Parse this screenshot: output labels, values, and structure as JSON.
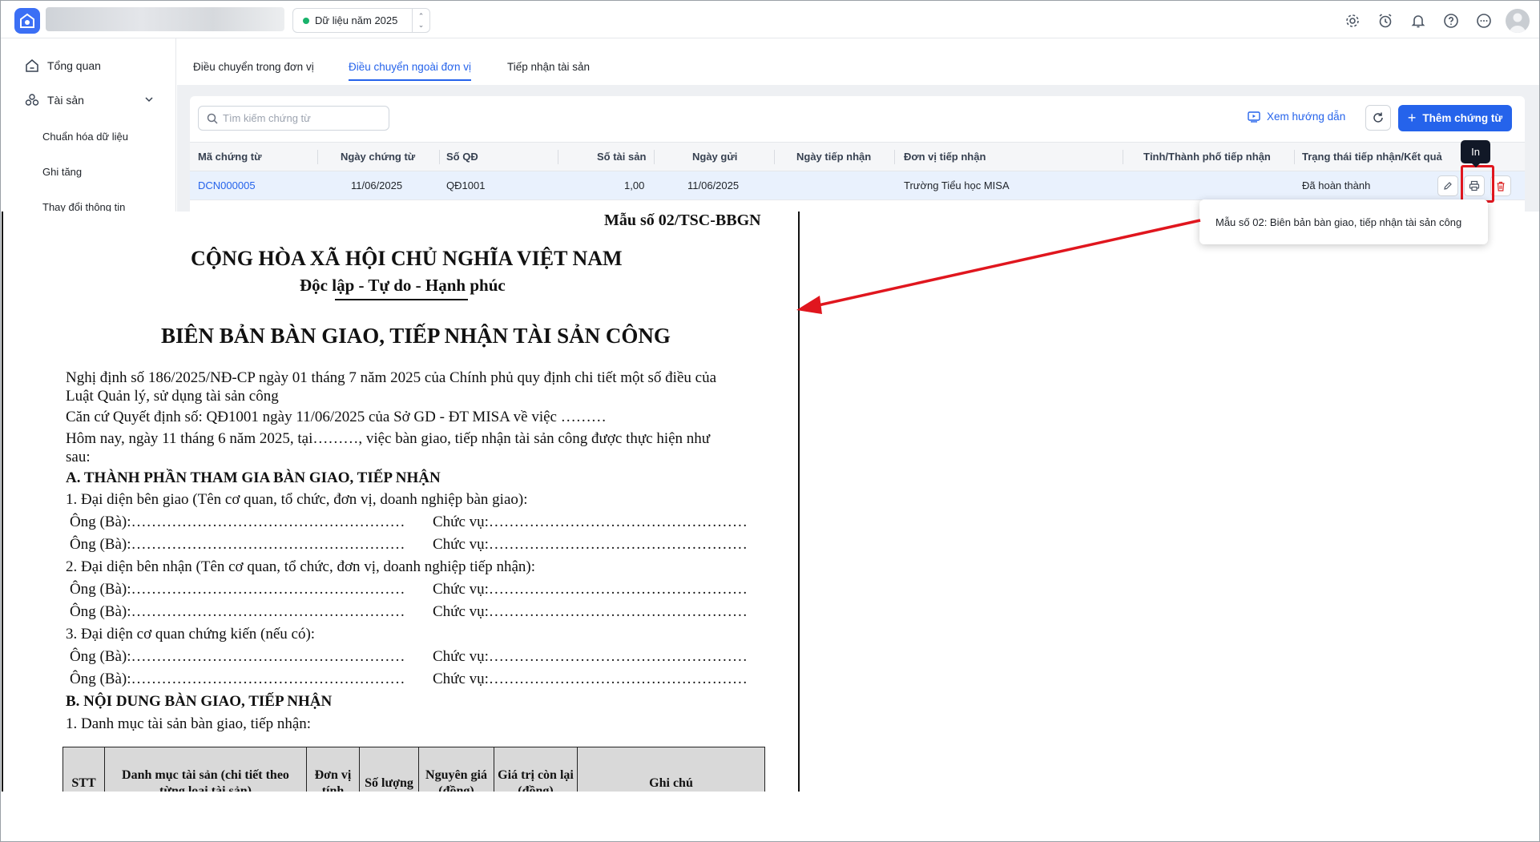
{
  "topbar": {
    "year_label": "Dữ liệu năm 2025",
    "stepper_up": "⌃",
    "stepper_down": "⌄",
    "icons": [
      "settings-icon",
      "alarm-icon",
      "bell-icon",
      "help-icon",
      "more-icon",
      "avatar"
    ]
  },
  "sidebar": {
    "overview": "Tổng quan",
    "assets": "Tài sản",
    "sub": [
      "Chuẩn hóa dữ liệu",
      "Ghi tăng",
      "Thay đổi thông tin"
    ]
  },
  "tabs": [
    "Điều chuyển trong đơn vị",
    "Điều chuyển ngoài đơn vị",
    "Tiếp nhận tài sản"
  ],
  "toolbar": {
    "search_placeholder": "Tìm kiếm chứng từ",
    "guide_label": "Xem hướng dẫn",
    "add_label": "Thêm chứng từ"
  },
  "table": {
    "headers": [
      "Mã chứng từ",
      "Ngày chứng từ",
      "Số QĐ",
      "Số tài sản",
      "Ngày gửi",
      "Ngày tiếp nhận",
      "Đơn vị tiếp nhận",
      "Tỉnh/Thành phố tiếp nhận",
      "Trạng thái tiếp nhận/Kết quả"
    ],
    "rows": [
      {
        "code": "DCN000005",
        "date": "11/06/2025",
        "decision": "QĐ1001",
        "count": "1,00",
        "sent": "11/06/2025",
        "received": "",
        "unit": "Trường Tiểu học MISA",
        "province": "",
        "status": "Đã hoàn thành"
      }
    ]
  },
  "tooltip": {
    "print": "In"
  },
  "print_menu": {
    "item": "Mẫu số 02: Biên bản bàn giao, tiếp nhận tài sản công"
  },
  "colors": {
    "accent": "#2563eb",
    "highlight": "#e0161e",
    "row_selected": "#e9f1fd"
  },
  "document": {
    "form_no": "Mẫu số 02/TSC-BBGN",
    "nation": "CỘNG HÒA XÃ HỘI CHỦ NGHĨA VIỆT NAM",
    "motto": "Độc lập - Tự do - Hạnh phúc",
    "title": "BIÊN BẢN BÀN GIAO, TIẾP NHẬN TÀI SẢN CÔNG",
    "p1a": "Nghị định số 186/2025/NĐ-CP ngày 01 tháng 7 năm 2025 của Chính phủ quy định chi tiết một số điều của",
    "p1b": "Luật Quản lý, sử dụng tài sản công",
    "p2": "Căn cứ Quyết định số: QĐ1001 ngày 11/06/2025 của Sở GD - ĐT MISA về việc ………",
    "p3a": "Hôm nay, ngày 11 tháng 6 năm 2025, tại………, việc bàn giao, tiếp nhận tài sản công được thực hiện như",
    "p3b": "sau:",
    "secA": "A. THÀNH PHẦN THAM GIA BÀN GIAO, TIẾP NHẬN",
    "a1": "1. Đại diện bên giao (Tên cơ quan, tổ chức, đơn vị, doanh nghiệp bàn giao):",
    "a2": "2. Đại diện bên nhận (Tên cơ quan, tổ chức, đơn vị, doanh nghiệp tiếp nhận):",
    "a3": "3. Đại diện cơ quan chứng kiến (nếu có):",
    "person": "Ông (Bà):………………………………………………",
    "position": "Chức vụ:……………………………………………",
    "secB": "B. NỘI DUNG BÀN GIAO, TIẾP NHẬN",
    "b1": "1. Danh mục tài sản bàn giao, tiếp nhận:",
    "table_headers": [
      "STT",
      "Danh mục tài sản (chi tiết theo từng loại tài sản)",
      "Đơn vị tính",
      "Số lượng",
      "Nguyên giá (đồng)",
      "Giá trị còn lại (đồng)",
      "Ghi chú"
    ]
  }
}
